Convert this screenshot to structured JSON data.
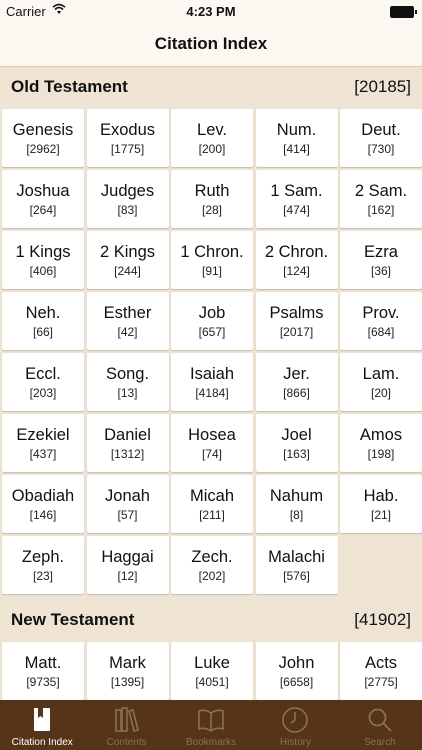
{
  "status_bar": {
    "carrier": "Carrier",
    "time": "4:23 PM"
  },
  "nav": {
    "title": "Citation Index"
  },
  "old_testament": {
    "title": "Old Testament",
    "count": "[20185]",
    "books": [
      {
        "name": "Genesis",
        "count": "[2962]"
      },
      {
        "name": "Exodus",
        "count": "[1775]"
      },
      {
        "name": "Lev.",
        "count": "[200]"
      },
      {
        "name": "Num.",
        "count": "[414]"
      },
      {
        "name": "Deut.",
        "count": "[730]"
      },
      {
        "name": "Joshua",
        "count": "[264]"
      },
      {
        "name": "Judges",
        "count": "[83]"
      },
      {
        "name": "Ruth",
        "count": "[28]"
      },
      {
        "name": "1 Sam.",
        "count": "[474]"
      },
      {
        "name": "2 Sam.",
        "count": "[162]"
      },
      {
        "name": "1 Kings",
        "count": "[406]"
      },
      {
        "name": "2 Kings",
        "count": "[244]"
      },
      {
        "name": "1 Chron.",
        "count": "[91]"
      },
      {
        "name": "2 Chron.",
        "count": "[124]"
      },
      {
        "name": "Ezra",
        "count": "[36]"
      },
      {
        "name": "Neh.",
        "count": "[66]"
      },
      {
        "name": "Esther",
        "count": "[42]"
      },
      {
        "name": "Job",
        "count": "[657]"
      },
      {
        "name": "Psalms",
        "count": "[2017]"
      },
      {
        "name": "Prov.",
        "count": "[684]"
      },
      {
        "name": "Eccl.",
        "count": "[203]"
      },
      {
        "name": "Song.",
        "count": "[13]"
      },
      {
        "name": "Isaiah",
        "count": "[4184]"
      },
      {
        "name": "Jer.",
        "count": "[866]"
      },
      {
        "name": "Lam.",
        "count": "[20]"
      },
      {
        "name": "Ezekiel",
        "count": "[437]"
      },
      {
        "name": "Daniel",
        "count": "[1312]"
      },
      {
        "name": "Hosea",
        "count": "[74]"
      },
      {
        "name": "Joel",
        "count": "[163]"
      },
      {
        "name": "Amos",
        "count": "[198]"
      },
      {
        "name": "Obadiah",
        "count": "[146]"
      },
      {
        "name": "Jonah",
        "count": "[57]"
      },
      {
        "name": "Micah",
        "count": "[211]"
      },
      {
        "name": "Nahum",
        "count": "[8]"
      },
      {
        "name": "Hab.",
        "count": "[21]"
      },
      {
        "name": "Zeph.",
        "count": "[23]"
      },
      {
        "name": "Haggai",
        "count": "[12]"
      },
      {
        "name": "Zech.",
        "count": "[202]"
      },
      {
        "name": "Malachi",
        "count": "[576]"
      }
    ]
  },
  "new_testament": {
    "title": "New Testament",
    "count": "[41902]",
    "books": [
      {
        "name": "Matt.",
        "count": "[9735]"
      },
      {
        "name": "Mark",
        "count": "[1395]"
      },
      {
        "name": "Luke",
        "count": "[4051]"
      },
      {
        "name": "John",
        "count": "[6658]"
      },
      {
        "name": "Acts",
        "count": "[2775]"
      }
    ]
  },
  "tabs": [
    {
      "label": "Citation Index",
      "icon": "book-bookmark-icon",
      "active": true
    },
    {
      "label": "Contents",
      "icon": "library-books-icon",
      "active": false
    },
    {
      "label": "Bookmarks",
      "icon": "open-book-icon",
      "active": false
    },
    {
      "label": "History",
      "icon": "clock-icon",
      "active": false
    },
    {
      "label": "Search",
      "icon": "search-icon",
      "active": false
    }
  ],
  "colors": {
    "tabbar_bg": "#553417",
    "background": "#efe4d3",
    "tab_active": "#ffffff",
    "tab_inactive": "#8c6f54"
  }
}
